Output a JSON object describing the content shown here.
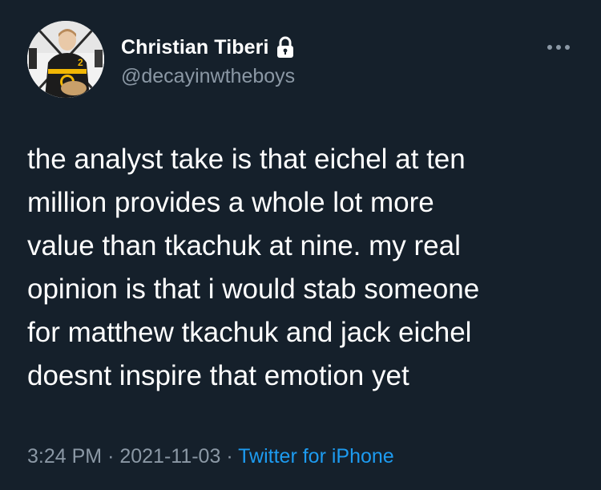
{
  "author": {
    "display_name": "Christian Tiberi",
    "handle": "@decayinwtheboys",
    "protected_icon": "lock-icon",
    "avatar_icon": "avatar-photo"
  },
  "menu_icon": "more-horizontal-icon",
  "tweet": {
    "lines": [
      "the analyst take is that eichel at ten",
      "million provides a whole lot more",
      "value than tkachuk at nine. my real",
      "opinion is that i would stab someone",
      "for matthew tkachuk and jack eichel",
      "doesnt inspire that emotion yet"
    ],
    "time": "3:24 PM",
    "date": "2021-11-03",
    "separator": "·",
    "source": "Twitter for iPhone"
  },
  "colors": {
    "background": "#15202b",
    "text": "#ffffff",
    "secondary": "#8b98a5",
    "link": "#1d9bf0"
  }
}
